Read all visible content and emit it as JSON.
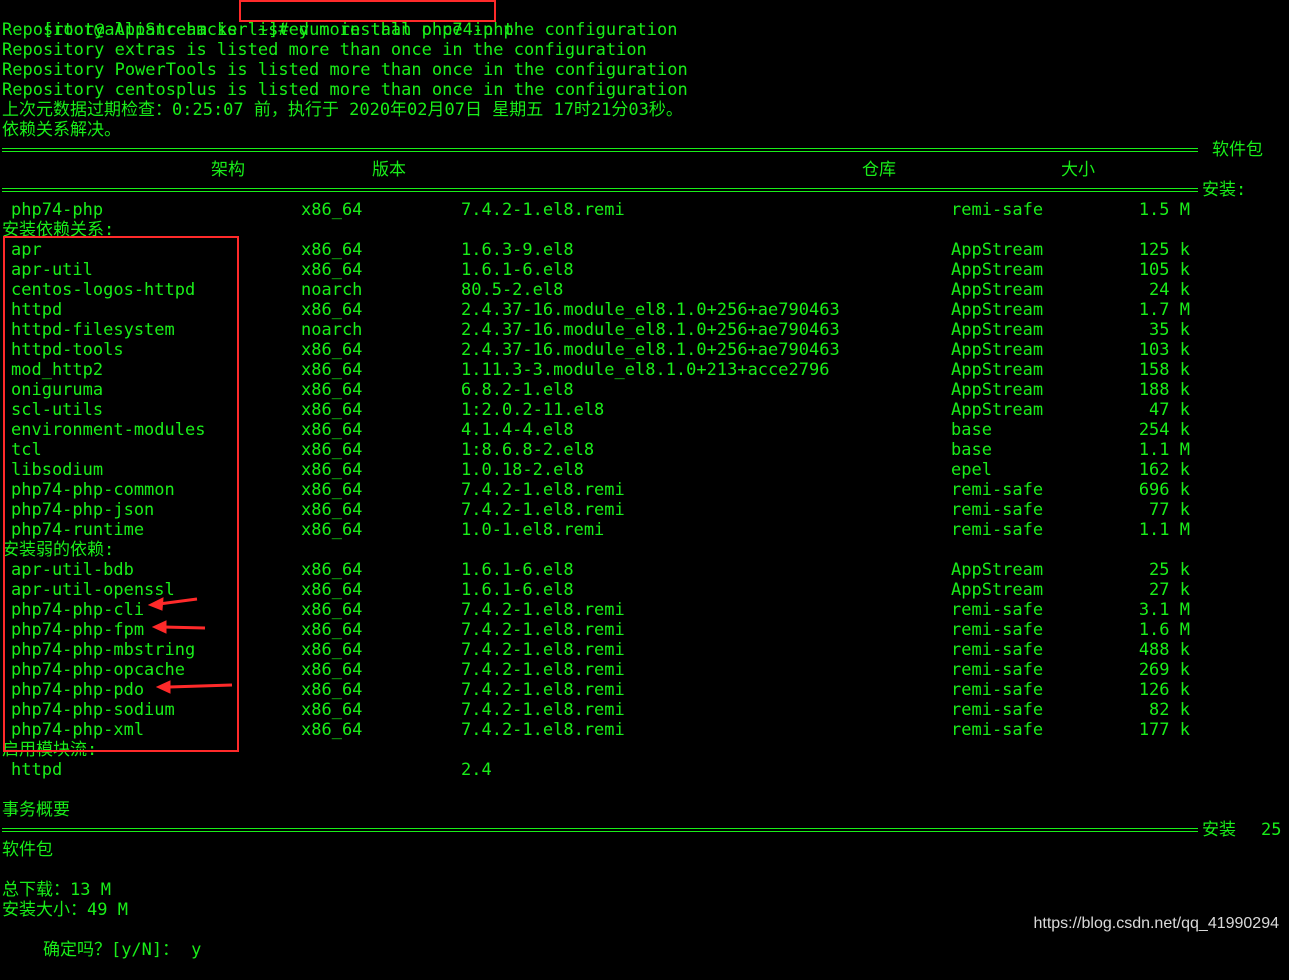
{
  "terminal": {
    "prompt": "[root@alliancehacker ~]# ",
    "command": "yum install php74-php",
    "warnings": [
      "Repository AppStream is listed more than once in the configuration",
      "Repository extras is listed more than once in the configuration",
      "Repository PowerTools is listed more than once in the configuration",
      "Repository centosplus is listed more than once in the configuration"
    ],
    "metadata_check": "上次元数据过期检查：0:25:07 前，执行于 2020年02月07日 星期五 17时21分03秒。",
    "deps_resolved": "依赖关系解决。",
    "header": {
      "package": "软件包",
      "arch": "架构",
      "version": "版本",
      "repo": "仓库",
      "size": "大小"
    },
    "section_install": "安装:",
    "install_rows": [
      {
        "pkg": "php74-php",
        "arch": "x86_64",
        "ver": "7.4.2-1.el8.remi",
        "repo": "remi-safe",
        "size": "1.5 M"
      }
    ],
    "section_deps": "安装依赖关系:",
    "dep_rows": [
      {
        "pkg": "apr",
        "arch": "x86_64",
        "ver": "1.6.3-9.el8",
        "repo": "AppStream",
        "size": "125 k"
      },
      {
        "pkg": "apr-util",
        "arch": "x86_64",
        "ver": "1.6.1-6.el8",
        "repo": "AppStream",
        "size": "105 k"
      },
      {
        "pkg": "centos-logos-httpd",
        "arch": "noarch",
        "ver": "80.5-2.el8",
        "repo": "AppStream",
        "size": "24 k"
      },
      {
        "pkg": "httpd",
        "arch": "x86_64",
        "ver": "2.4.37-16.module_el8.1.0+256+ae790463",
        "repo": "AppStream",
        "size": "1.7 M"
      },
      {
        "pkg": "httpd-filesystem",
        "arch": "noarch",
        "ver": "2.4.37-16.module_el8.1.0+256+ae790463",
        "repo": "AppStream",
        "size": "35 k"
      },
      {
        "pkg": "httpd-tools",
        "arch": "x86_64",
        "ver": "2.4.37-16.module_el8.1.0+256+ae790463",
        "repo": "AppStream",
        "size": "103 k"
      },
      {
        "pkg": "mod_http2",
        "arch": "x86_64",
        "ver": "1.11.3-3.module_el8.1.0+213+acce2796",
        "repo": "AppStream",
        "size": "158 k"
      },
      {
        "pkg": "oniguruma",
        "arch": "x86_64",
        "ver": "6.8.2-1.el8",
        "repo": "AppStream",
        "size": "188 k"
      },
      {
        "pkg": "scl-utils",
        "arch": "x86_64",
        "ver": "1:2.0.2-11.el8",
        "repo": "AppStream",
        "size": "47 k"
      },
      {
        "pkg": "environment-modules",
        "arch": "x86_64",
        "ver": "4.1.4-4.el8",
        "repo": "base",
        "size": "254 k"
      },
      {
        "pkg": "tcl",
        "arch": "x86_64",
        "ver": "1:8.6.8-2.el8",
        "repo": "base",
        "size": "1.1 M"
      },
      {
        "pkg": "libsodium",
        "arch": "x86_64",
        "ver": "1.0.18-2.el8",
        "repo": "epel",
        "size": "162 k"
      },
      {
        "pkg": "php74-php-common",
        "arch": "x86_64",
        "ver": "7.4.2-1.el8.remi",
        "repo": "remi-safe",
        "size": "696 k"
      },
      {
        "pkg": "php74-php-json",
        "arch": "x86_64",
        "ver": "7.4.2-1.el8.remi",
        "repo": "remi-safe",
        "size": "77 k"
      },
      {
        "pkg": "php74-runtime",
        "arch": "x86_64",
        "ver": "1.0-1.el8.remi",
        "repo": "remi-safe",
        "size": "1.1 M"
      }
    ],
    "section_weak": "安装弱的依赖:",
    "weak_rows": [
      {
        "pkg": "apr-util-bdb",
        "arch": "x86_64",
        "ver": "1.6.1-6.el8",
        "repo": "AppStream",
        "size": "25 k"
      },
      {
        "pkg": "apr-util-openssl",
        "arch": "x86_64",
        "ver": "1.6.1-6.el8",
        "repo": "AppStream",
        "size": "27 k"
      },
      {
        "pkg": "php74-php-cli",
        "arch": "x86_64",
        "ver": "7.4.2-1.el8.remi",
        "repo": "remi-safe",
        "size": "3.1 M"
      },
      {
        "pkg": "php74-php-fpm",
        "arch": "x86_64",
        "ver": "7.4.2-1.el8.remi",
        "repo": "remi-safe",
        "size": "1.6 M"
      },
      {
        "pkg": "php74-php-mbstring",
        "arch": "x86_64",
        "ver": "7.4.2-1.el8.remi",
        "repo": "remi-safe",
        "size": "488 k"
      },
      {
        "pkg": "php74-php-opcache",
        "arch": "x86_64",
        "ver": "7.4.2-1.el8.remi",
        "repo": "remi-safe",
        "size": "269 k"
      },
      {
        "pkg": "php74-php-pdo",
        "arch": "x86_64",
        "ver": "7.4.2-1.el8.remi",
        "repo": "remi-safe",
        "size": "126 k"
      },
      {
        "pkg": "php74-php-sodium",
        "arch": "x86_64",
        "ver": "7.4.2-1.el8.remi",
        "repo": "remi-safe",
        "size": "82 k"
      },
      {
        "pkg": "php74-php-xml",
        "arch": "x86_64",
        "ver": "7.4.2-1.el8.remi",
        "repo": "remi-safe",
        "size": "177 k"
      }
    ],
    "section_module": "启用模块流:",
    "module_rows": [
      {
        "pkg": "httpd",
        "ver": "2.4"
      }
    ],
    "summary_title": "事务概要",
    "summary_install": "安装",
    "summary_count": "25",
    "summary_unit": "软件包",
    "total_download": "总下载：13 M",
    "installed_size": "安装大小：49 M",
    "confirm": "确定吗？[y/N]：",
    "answer": "y"
  },
  "annotations": {
    "highlight_color": "#ff2a2a",
    "arrow_targets": [
      "php74-php-cli",
      "php74-php-fpm",
      "php74-php-pdo"
    ]
  },
  "watermark": "https://blog.csdn.net/qq_41990294"
}
